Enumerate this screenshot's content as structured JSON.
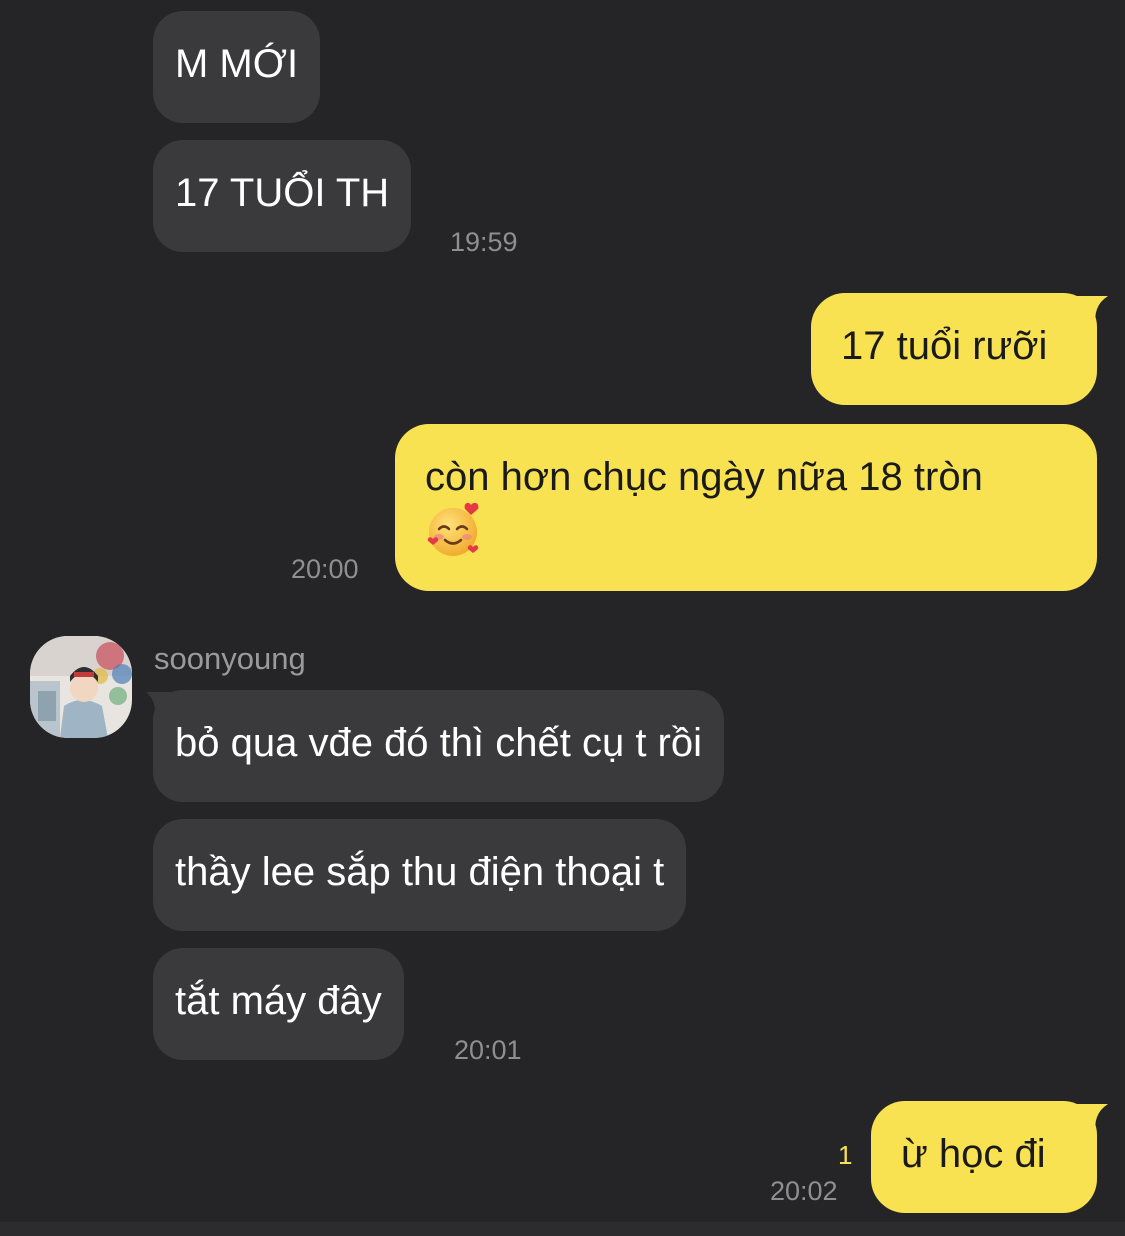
{
  "messages": {
    "m1": "M MỚI",
    "m2": "17 TUỔI TH",
    "t1": "19:59",
    "m3": "17 tuổi rưỡi",
    "m4_line1": "còn hơn chục ngày nữa 18 tròn",
    "m4_emoji": "smiling-face-with-hearts",
    "t2": "20:00",
    "sender": "soonyoung",
    "m5": "bỏ qua vđe đó thì chết cụ t rồi",
    "m6": "thầy lee sắp thu điện thoại t",
    "m7": "tắt máy đây",
    "t3": "20:01",
    "unread_count": "1",
    "m8": "ừ học đi",
    "t4": "20:02"
  },
  "colors": {
    "background": "#252527",
    "incoming_bubble": "#3a3a3c",
    "outgoing_bubble": "#f9e251",
    "timestamp": "#8e8e93",
    "unread": "#f9e251"
  }
}
